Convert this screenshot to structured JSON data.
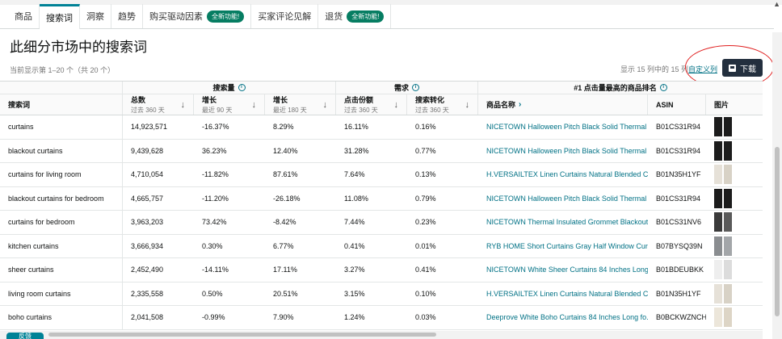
{
  "tabs": [
    {
      "label": "商品",
      "badge": ""
    },
    {
      "label": "搜索词",
      "badge": ""
    },
    {
      "label": "洞察",
      "badge": ""
    },
    {
      "label": "趋势",
      "badge": ""
    },
    {
      "label": "购买驱动因素",
      "badge": "全新功能!"
    },
    {
      "label": "买家评论见解",
      "badge": ""
    },
    {
      "label": "退货",
      "badge": "全新功能!"
    }
  ],
  "page": {
    "title": "此细分市场中的搜索词",
    "showing": "当前显示第 1–20 个（共 20 个）",
    "cols_shown": "显示 15 列中的 15 列",
    "custom_cols": "自定义列",
    "download_label": "下载",
    "feedback_label": "反馈"
  },
  "table": {
    "groups": {
      "search_volume": "搜索量",
      "demand": "需求",
      "top_product": "#1 点击量最高的商品排名"
    },
    "headers": {
      "keyword": "搜索词",
      "total": {
        "label": "总数",
        "sub": "过去 360 天"
      },
      "growth90": {
        "label": "增长",
        "sub": "最近 90 天"
      },
      "growth180": {
        "label": "增长",
        "sub": "最近 180 天"
      },
      "click_share": {
        "label": "点击份额",
        "sub": "过去 360 天"
      },
      "conversion": {
        "label": "搜索转化",
        "sub": "过去 360 天"
      },
      "product_name": "商品名称",
      "asin": "ASIN",
      "image": "图片"
    },
    "rows": [
      {
        "keyword": "curtains",
        "total": "14,923,571",
        "g90": "-16.37%",
        "g180": "8.29%",
        "click": "16.11%",
        "conv": "0.16%",
        "product": "NICETOWN Halloween Pitch Black Solid Thermal ...",
        "asin": "B01CS31R94",
        "thumb": [
          "#1c1c1c",
          "#1c1c1c"
        ]
      },
      {
        "keyword": "blackout curtains",
        "total": "9,439,628",
        "g90": "36.23%",
        "g180": "12.40%",
        "click": "31.28%",
        "conv": "0.77%",
        "product": "NICETOWN Halloween Pitch Black Solid Thermal ...",
        "asin": "B01CS31R94",
        "thumb": [
          "#1c1c1c",
          "#1c1c1c"
        ]
      },
      {
        "keyword": "curtains for living room",
        "total": "4,710,054",
        "g90": "-11.82%",
        "g180": "87.61%",
        "click": "7.64%",
        "conv": "0.13%",
        "product": "H.VERSAILTEX Linen Curtains Natural Blended Cu...",
        "asin": "B01N35H1YF",
        "thumb": [
          "#e6e1d8",
          "#d8d2c6"
        ]
      },
      {
        "keyword": "blackout curtains for bedroom",
        "total": "4,665,757",
        "g90": "-11.20%",
        "g180": "-26.18%",
        "click": "11.08%",
        "conv": "0.79%",
        "product": "NICETOWN Halloween Pitch Black Solid Thermal ...",
        "asin": "B01CS31R94",
        "thumb": [
          "#1c1c1c",
          "#1c1c1c"
        ]
      },
      {
        "keyword": "curtains for bedroom",
        "total": "3,963,203",
        "g90": "73.42%",
        "g180": "-8.42%",
        "click": "7.44%",
        "conv": "0.23%",
        "product": "NICETOWN Thermal Insulated Grommet Blackout...",
        "asin": "B01CS31NV6",
        "thumb": [
          "#3a3a3a",
          "#5a5a5a"
        ]
      },
      {
        "keyword": "kitchen curtains",
        "total": "3,666,934",
        "g90": "0.30%",
        "g180": "6.77%",
        "click": "0.41%",
        "conv": "0.01%",
        "product": "RYB HOME Short Curtains Gray Half Window Cur...",
        "asin": "B07BYSQ39N",
        "thumb": [
          "#8a8d90",
          "#a3a6a9"
        ]
      },
      {
        "keyword": "sheer curtains",
        "total": "2,452,490",
        "g90": "-14.11%",
        "g180": "17.11%",
        "click": "3.27%",
        "conv": "0.41%",
        "product": "NICETOWN White Sheer Curtains 84 Inches Long ...",
        "asin": "B01BDEUBKK",
        "thumb": [
          "#eeeeee",
          "#dcdcdc"
        ]
      },
      {
        "keyword": "living room curtains",
        "total": "2,335,558",
        "g90": "0.50%",
        "g180": "20.51%",
        "click": "3.15%",
        "conv": "0.10%",
        "product": "H.VERSAILTEX Linen Curtains Natural Blended Cu...",
        "asin": "B01N35H1YF",
        "thumb": [
          "#e6e1d8",
          "#d8d2c6"
        ]
      },
      {
        "keyword": "boho curtains",
        "total": "2,041,508",
        "g90": "-0.99%",
        "g180": "7.90%",
        "click": "1.24%",
        "conv": "0.03%",
        "product": "Deeprove White Boho Curtains 84 Inches Long fo...",
        "asin": "B0BCKWZNCH",
        "thumb": [
          "#ece6da",
          "#ddd5c6"
        ]
      }
    ]
  }
}
